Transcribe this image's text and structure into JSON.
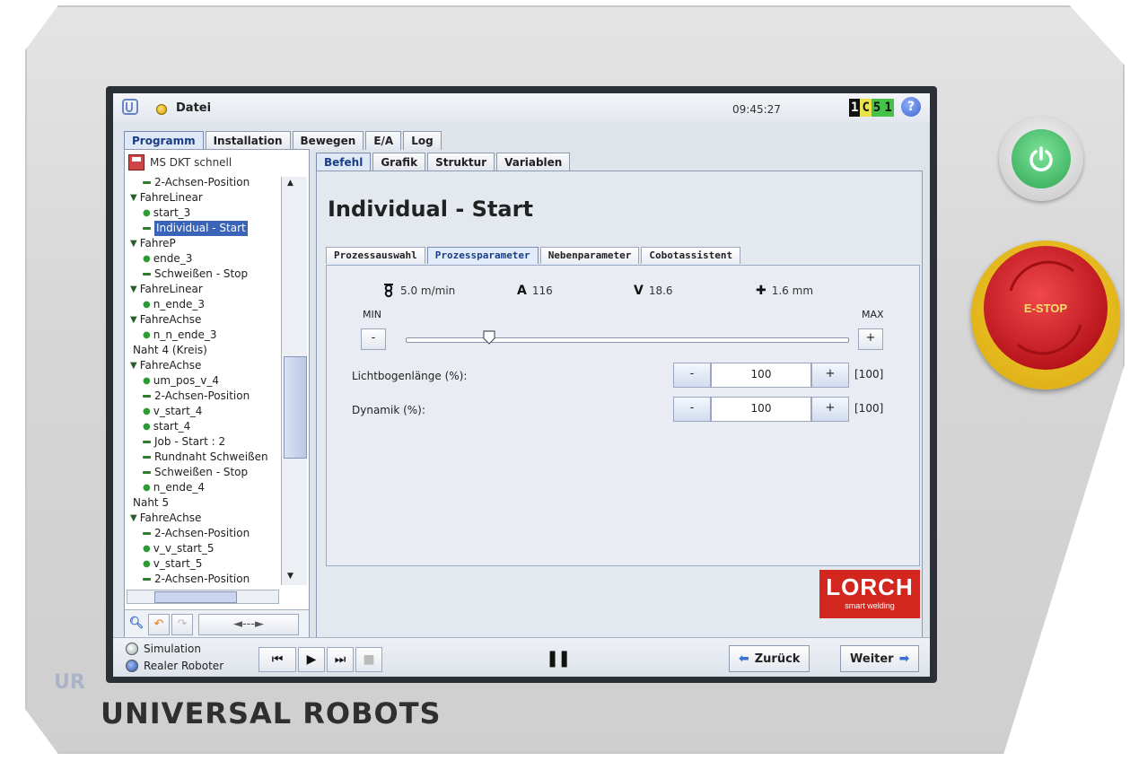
{
  "app": {
    "file_label": "Datei",
    "clock": "09:45:27",
    "status_badge": [
      "1",
      "C",
      "5",
      "1"
    ],
    "help_symbol": "?"
  },
  "colors": {
    "accent": "#3a64b8",
    "lorch_red": "#d3261f",
    "estop_red": "#c8161d",
    "estop_yellow": "#e9bd1e",
    "power_green": "#2ea653"
  },
  "main_tabs": [
    "Programm",
    "Installation",
    "Bewegen",
    "E/A",
    "Log"
  ],
  "sub_tabs": [
    "Befehl",
    "Grafik",
    "Struktur",
    "Variablen"
  ],
  "program": {
    "name": "MS DKT schnell",
    "tree": [
      {
        "label": "2-Achsen-Position",
        "type": "bar",
        "indent": 1
      },
      {
        "label": "FahreLinear",
        "type": "group",
        "indent": 0
      },
      {
        "label": "start_3",
        "type": "dot",
        "indent": 1
      },
      {
        "label": "Individual - Start",
        "type": "bar",
        "indent": 1,
        "selected": true
      },
      {
        "label": "FahreP",
        "type": "group",
        "indent": 0
      },
      {
        "label": "ende_3",
        "type": "dot",
        "indent": 1
      },
      {
        "label": "Schweißen - Stop",
        "type": "bar",
        "indent": 1
      },
      {
        "label": "FahreLinear",
        "type": "group",
        "indent": 0
      },
      {
        "label": "n_ende_3",
        "type": "dot",
        "indent": 1
      },
      {
        "label": "FahreAchse",
        "type": "group",
        "indent": 0
      },
      {
        "label": "n_n_ende_3",
        "type": "dot",
        "indent": 1
      },
      {
        "label": "Naht 4 (Kreis)",
        "type": "text",
        "indent": 0
      },
      {
        "label": "FahreAchse",
        "type": "group",
        "indent": 0
      },
      {
        "label": "um_pos_v_4",
        "type": "dot",
        "indent": 1
      },
      {
        "label": "2-Achsen-Position",
        "type": "bar",
        "indent": 1
      },
      {
        "label": "v_start_4",
        "type": "dot",
        "indent": 1
      },
      {
        "label": "start_4",
        "type": "dot",
        "indent": 1
      },
      {
        "label": "Job - Start : 2",
        "type": "bar",
        "indent": 1
      },
      {
        "label": "Rundnaht Schweißen",
        "type": "bar",
        "indent": 1
      },
      {
        "label": "Schweißen - Stop",
        "type": "bar",
        "indent": 1
      },
      {
        "label": "n_ende_4",
        "type": "dot",
        "indent": 1
      },
      {
        "label": "Naht 5",
        "type": "text",
        "indent": 0
      },
      {
        "label": "FahreAchse",
        "type": "group",
        "indent": 0
      },
      {
        "label": "2-Achsen-Position",
        "type": "bar",
        "indent": 1
      },
      {
        "label": "v_v_start_5",
        "type": "dot",
        "indent": 1
      },
      {
        "label": "v_start_5",
        "type": "dot",
        "indent": 1
      },
      {
        "label": "2-Achsen-Position",
        "type": "bar",
        "indent": 1
      }
    ]
  },
  "tree_tools": {
    "search_icon": "search-icon",
    "undo_icon": "undo-icon",
    "redo_icon": "redo-icon",
    "move_arrows": "◄---►"
  },
  "content": {
    "title": "Individual - Start",
    "inner_tabs": [
      "Prozessauswahl",
      "Prozessparameter",
      "Nebenparameter",
      "Cobotassistent"
    ],
    "active_inner_tab": 1,
    "readouts": {
      "wire_speed": "5.0 m/min",
      "current_label": "A",
      "current_value": "116",
      "voltage_label": "V",
      "voltage_value": "18.6",
      "thickness": "1.6 mm"
    },
    "slider": {
      "min_label": "MIN",
      "max_label": "MAX",
      "minus": "-",
      "plus": "+",
      "position_fraction": 0.19
    },
    "params": [
      {
        "label": "Lichtbogenlänge (%):",
        "value": "100",
        "range": "[100]",
        "minus": "-",
        "plus": "+"
      },
      {
        "label": "Dynamik (%):",
        "value": "100",
        "range": "[100]",
        "minus": "-",
        "plus": "+"
      }
    ],
    "logo": {
      "line1": "LORCH",
      "line2": "smart welding"
    }
  },
  "footer": {
    "mode_simulation": "Simulation",
    "mode_real": "Realer Roboter",
    "back_label": "Zurück",
    "next_label": "Weiter"
  },
  "hardware": {
    "brand": "UNIVERSAL ROBOTS",
    "estop_label": "E-STOP"
  }
}
